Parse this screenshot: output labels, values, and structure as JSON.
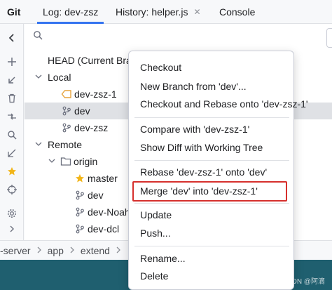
{
  "tabs": [
    {
      "label": "Git"
    },
    {
      "label": "Log: dev-zsz"
    },
    {
      "label": "History: helper.js",
      "close": "✕"
    },
    {
      "label": "Console"
    }
  ],
  "tree": {
    "head": "HEAD (Current Bra",
    "local_label": "Local",
    "local_branches": [
      "dev-zsz-1",
      "dev",
      "dev-zsz"
    ],
    "remote_label": "Remote",
    "origin_label": "origin",
    "remote_branches": [
      "master",
      "dev",
      "dev-Noah",
      "dev-dcl"
    ]
  },
  "breadcrumb": [
    "-server",
    "app",
    "extend"
  ],
  "menu": {
    "checkout": "Checkout",
    "new_branch": "New Branch from 'dev'...",
    "checkout_rebase": "Checkout and Rebase onto 'dev-zsz-1'",
    "compare": "Compare with 'dev-zsz-1'",
    "show_diff": "Show Diff with Working Tree",
    "rebase": "Rebase 'dev-zsz-1' onto 'dev'",
    "merge": "Merge 'dev' into 'dev-zsz-1'",
    "update": "Update",
    "push": "Push...",
    "rename": "Rename...",
    "delete": "Delete"
  },
  "watermark": "CSDN @阿滴",
  "colors": {
    "accent": "#3574f0",
    "highlight_border": "#d6302d",
    "bottom_bar": "#1f5f6f",
    "tag_icon": "#e6a23c",
    "star_icon": "#f2b519"
  }
}
